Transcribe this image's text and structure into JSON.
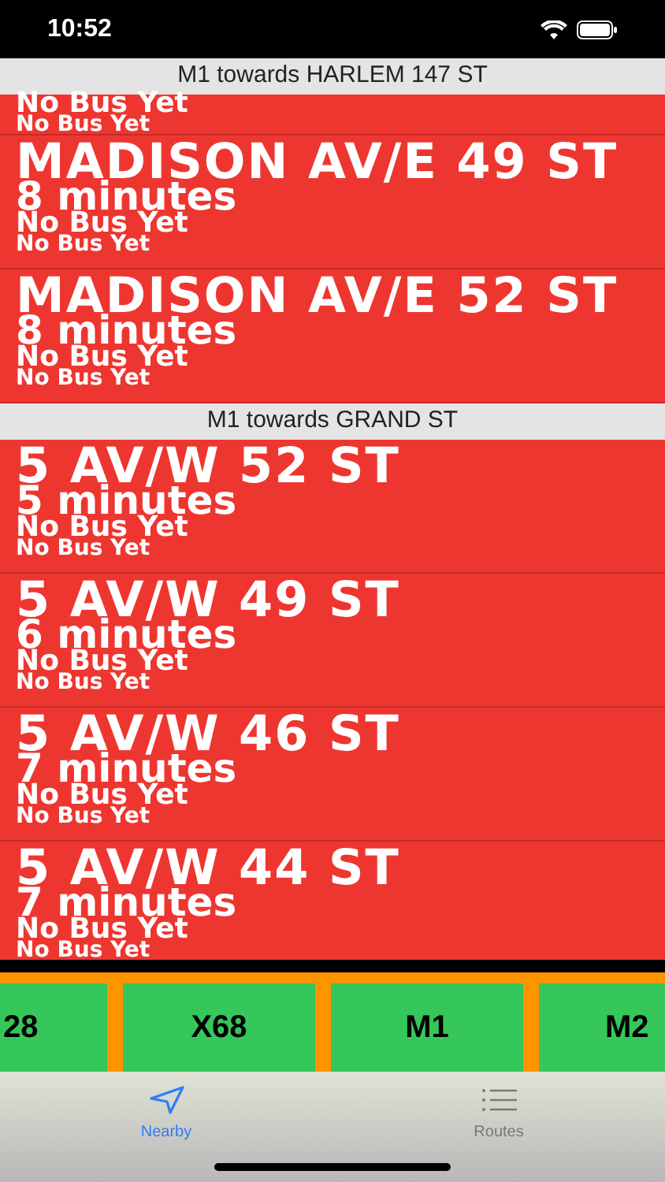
{
  "status_bar": {
    "time": "10:52"
  },
  "sections": [
    {
      "title": "M1 towards HARLEM 147 ST",
      "stops": [
        {
          "kind": "partial",
          "lines": [
            "No Bus Yet",
            "No Bus Yet"
          ]
        },
        {
          "kind": "full",
          "name": "MADISON AV/E 49 ST",
          "eta": "8 minutes",
          "lines": [
            "No Bus Yet",
            "No Bus Yet"
          ]
        },
        {
          "kind": "full",
          "name": "MADISON AV/E 52 ST",
          "eta": "8 minutes",
          "lines": [
            "No Bus Yet",
            "No Bus Yet"
          ]
        }
      ]
    },
    {
      "title": "M1 towards GRAND ST",
      "stops": [
        {
          "kind": "full",
          "name": "5 AV/W 52 ST",
          "eta": "5 minutes",
          "lines": [
            "No Bus Yet",
            "No Bus Yet"
          ]
        },
        {
          "kind": "full",
          "name": "5 AV/W 49 ST",
          "eta": "6 minutes",
          "lines": [
            "No Bus Yet",
            "No Bus Yet"
          ]
        },
        {
          "kind": "full",
          "name": "5 AV/W 46 ST",
          "eta": "7 minutes",
          "lines": [
            "No Bus Yet",
            "No Bus Yet"
          ]
        },
        {
          "kind": "full",
          "name": "5 AV/W 44 ST",
          "eta": "7 minutes",
          "lines": [
            "No Bus Yet",
            "No Bus Yet"
          ]
        }
      ]
    }
  ],
  "routes": [
    "28",
    "X68",
    "M1",
    "M2"
  ],
  "tabs": [
    {
      "label": "Nearby",
      "selected": true,
      "kind": "nearby"
    },
    {
      "label": "Routes",
      "selected": false,
      "kind": "routes"
    }
  ]
}
